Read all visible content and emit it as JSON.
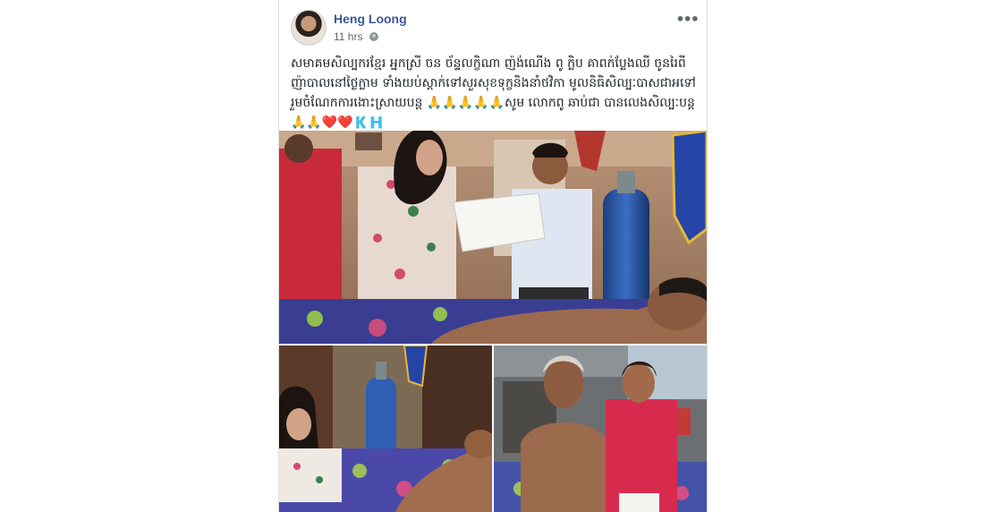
{
  "post": {
    "author": "Heng Loong",
    "time": "11 hrs",
    "privacy_icon": "globe-icon",
    "menu_icon": "more-options-icon",
    "text": "សមាគមសិល្បករខ្មែរ អ្នកស្រី ចន ច័ន្ទលក្ខិណា ញ៉ង់ណើង ពូ ក្លិប គាពក់ប្លែងឈី ចូនរៃពីញ៉ាបាលនៅថ្ងៃក្លាម ទាំងយប់ស្តាក់ទៅសួរសុខទុក្ខនិងនាំថវិកា មូលនិធិសិល្បៈបាសជាអទៅរួមចំណែកការងោះស្រាយបន្ត 🙏🙏🙏🙏🙏សូម លោកពូ ឆាប់ជា បានលេងសិល្បៈបន្ត🙏🙏❤️❤️🇰🇭"
  },
  "photos": [
    {
      "name": "photo-main",
      "subject": "visit-scene-envelope"
    },
    {
      "name": "photo-bottom-left",
      "subject": "woman-with-patient"
    },
    {
      "name": "photo-bottom-right",
      "subject": "elderly-couple"
    }
  ],
  "colors": {
    "author_link": "#385898",
    "meta_text": "#616770",
    "body_text": "#1d2129",
    "border": "#dddfe2"
  }
}
